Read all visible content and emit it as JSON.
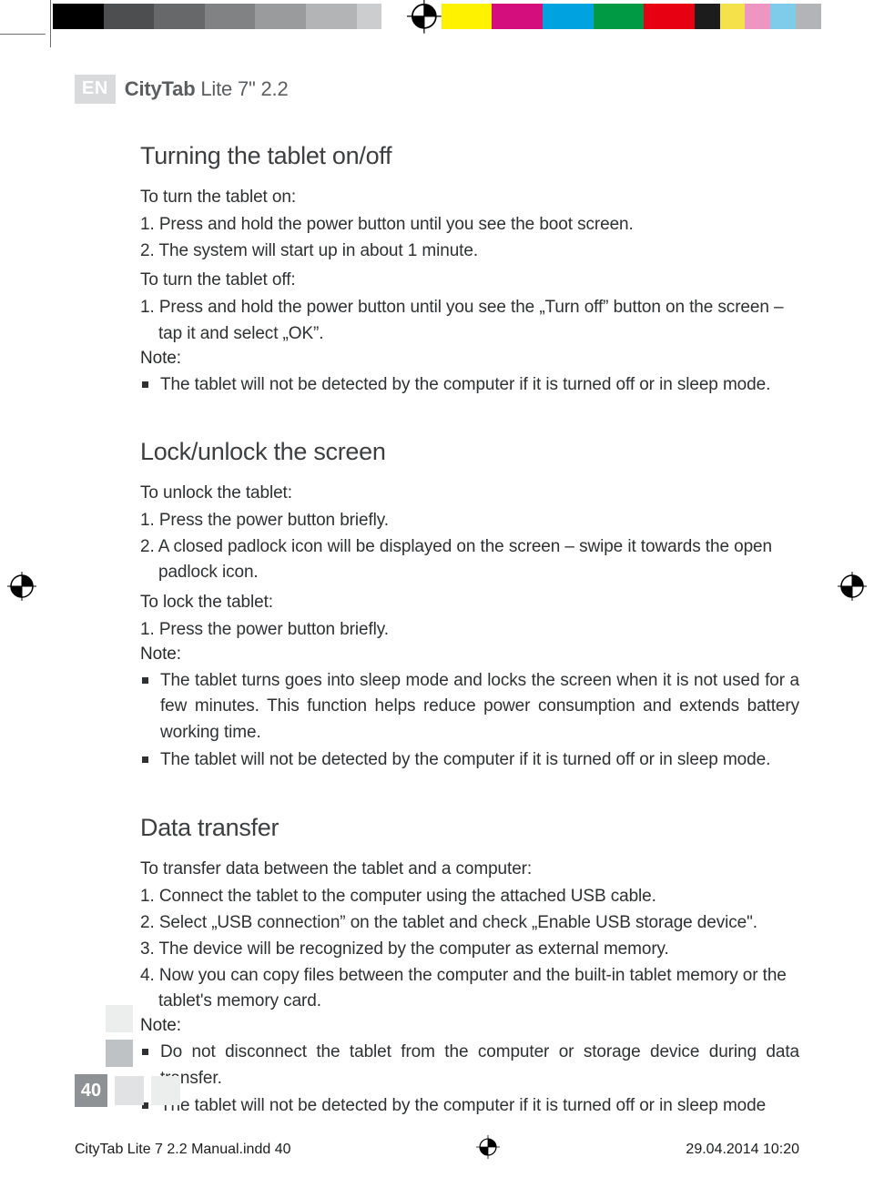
{
  "colorbar": [
    "#000000",
    "#000000",
    "#4d4e4f",
    "#4d4e4f",
    "#676869",
    "#676869",
    "#818283",
    "#818283",
    "#9a9b9c",
    "#9a9b9c",
    "#b3b4b5",
    "#b3b4b5",
    "#cccdce",
    "#ffffff",
    "gap",
    "#fff200",
    "#fff200",
    "#d40f7d",
    "#d40f7d",
    "#00a2e0",
    "#00a2e0",
    "#009944",
    "#009944",
    "#e60012",
    "#e60012",
    "#1c1c1c",
    "#f5e14a",
    "#ef95c2",
    "#7ecce9",
    "#b2b4b6"
  ],
  "header": {
    "lang_badge": "EN",
    "product_html": "<strong>CityTab</strong> Lite 7\" 2.2"
  },
  "sections": [
    {
      "heading": "Turning the tablet on/off",
      "groups": [
        {
          "type": "para",
          "text": "To turn the tablet on:"
        },
        {
          "type": "olist",
          "items": [
            "1. Press and hold the power button until you see the boot screen.",
            "2. The system will start up in about 1 minute."
          ]
        },
        {
          "type": "para",
          "text": "To turn the tablet off:"
        },
        {
          "type": "olist",
          "items": [
            "1. Press and hold the power button until you see the „Turn off” button on the screen – tap it and select „OK”."
          ]
        },
        {
          "type": "note",
          "label": "Note:",
          "bullets": [
            "The tablet will not be detected by the computer if it is turned off or in sleep mode."
          ]
        }
      ]
    },
    {
      "heading": "Lock/unlock the screen",
      "groups": [
        {
          "type": "para",
          "text": "To unlock the tablet:"
        },
        {
          "type": "olist",
          "items": [
            "1. Press the power button briefly.",
            "2. A closed padlock icon will be displayed on the screen – swipe it towards the open padlock icon."
          ]
        },
        {
          "type": "para",
          "text": "To lock the tablet:"
        },
        {
          "type": "olist",
          "items": [
            "1. Press the power button briefly."
          ]
        },
        {
          "type": "note",
          "label": "Note:",
          "bullets": [
            "The tablet turns goes into sleep mode and locks the screen when it is not used for a few minutes. This function helps reduce power consumption and extends battery working time.",
            "The tablet will not be detected by the computer if it is turned off or in sleep mode."
          ]
        }
      ]
    },
    {
      "heading": "Data transfer",
      "groups": [
        {
          "type": "para",
          "text": "To transfer data between the tablet and a computer:"
        },
        {
          "type": "olist",
          "items": [
            "1. Connect the tablet to the computer using the attached USB cable.",
            "2. Select „USB connection” on the tablet and check „Enable USB storage device\".",
            "3. The device will be recognized by the computer as external memory.",
            "4. Now you can copy files between the computer and the built-in tablet memory or the tablet's memory card."
          ]
        },
        {
          "type": "note",
          "label": "Note:",
          "bullets": [
            "Do not disconnect the tablet from the computer or storage device during data transfer.",
            "The tablet will not be detected by the computer if it is turned off or in sleep mode"
          ]
        }
      ]
    }
  ],
  "footer": {
    "page_number": "40",
    "filename": "CityTab Lite 7 2.2 Manual.indd   40",
    "datetime": "29.04.2014   10:20"
  }
}
